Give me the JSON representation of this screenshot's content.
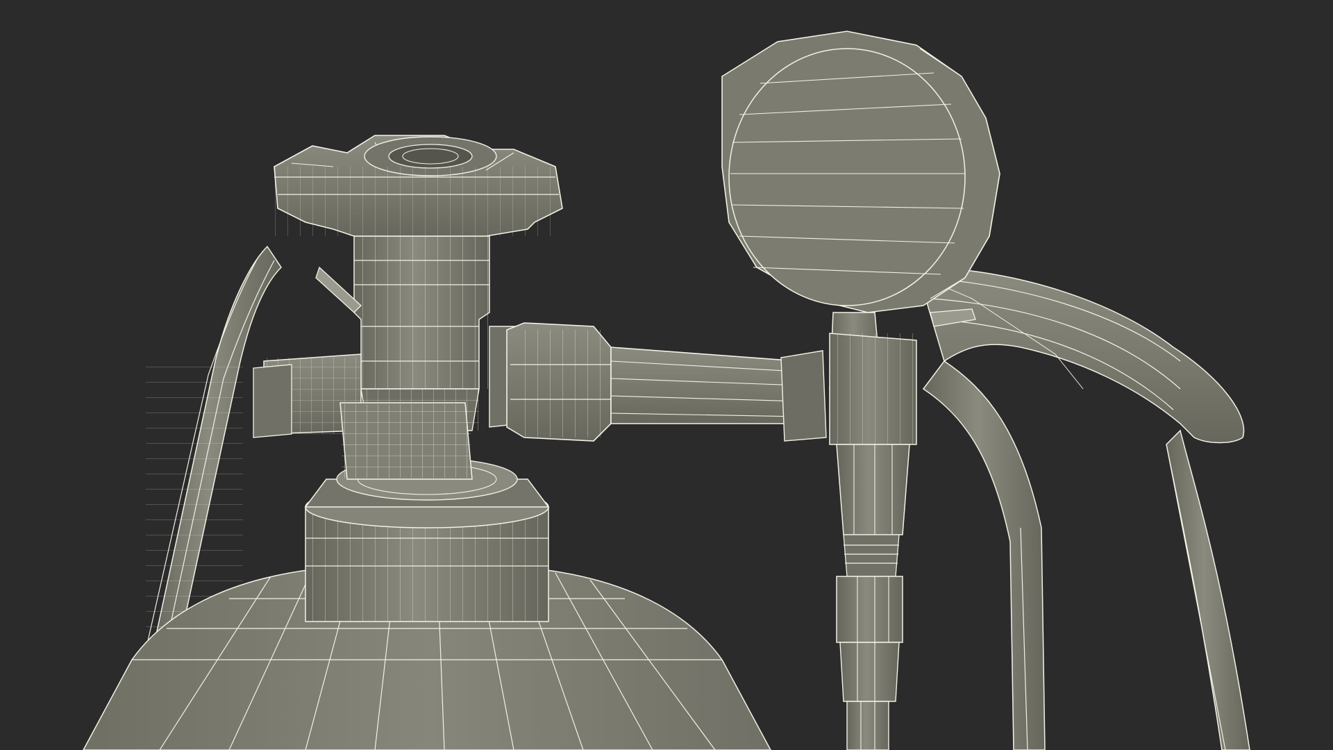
{
  "scene": {
    "background_color": "#2b2b2b",
    "surface_color": "#7b7b6f",
    "surface_shade_color": "#5f5f55",
    "wire_color": "#f2f2e6",
    "subject": "wireframe model"
  }
}
